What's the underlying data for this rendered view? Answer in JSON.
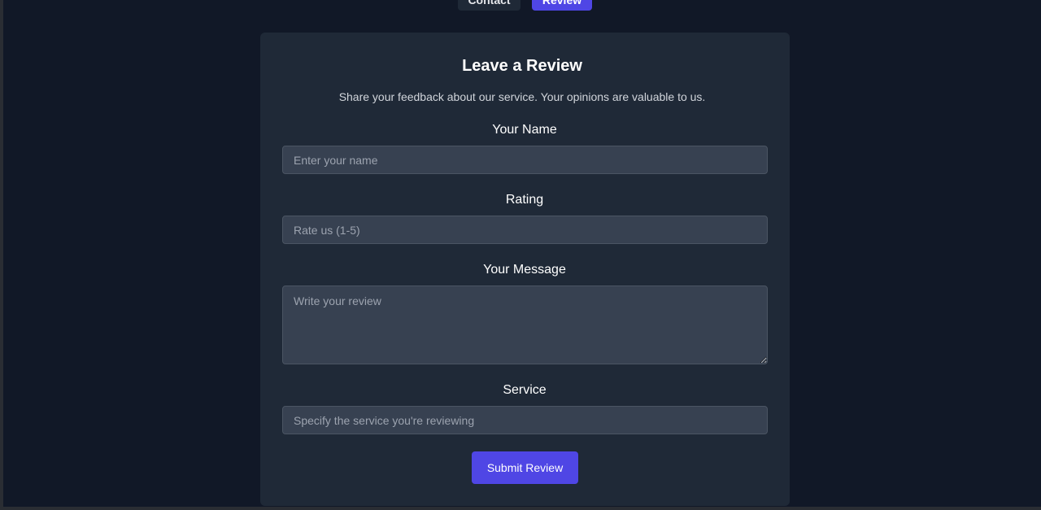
{
  "nav": {
    "contact_label": "Contact",
    "review_label": "Review"
  },
  "form": {
    "title": "Leave a Review",
    "subtitle": "Share your feedback about our service. Your opinions are valuable to us.",
    "name": {
      "label": "Your Name",
      "placeholder": "Enter your name",
      "value": ""
    },
    "rating": {
      "label": "Rating",
      "placeholder": "Rate us (1-5)",
      "value": ""
    },
    "message": {
      "label": "Your Message",
      "placeholder": "Write your review",
      "value": ""
    },
    "service": {
      "label": "Service",
      "placeholder": "Specify the service you're reviewing",
      "value": ""
    },
    "submit_label": "Submit Review"
  },
  "colors": {
    "page_background": "#111827",
    "card_background": "#1f2937",
    "input_background": "#374151",
    "accent": "#4f46e5"
  }
}
